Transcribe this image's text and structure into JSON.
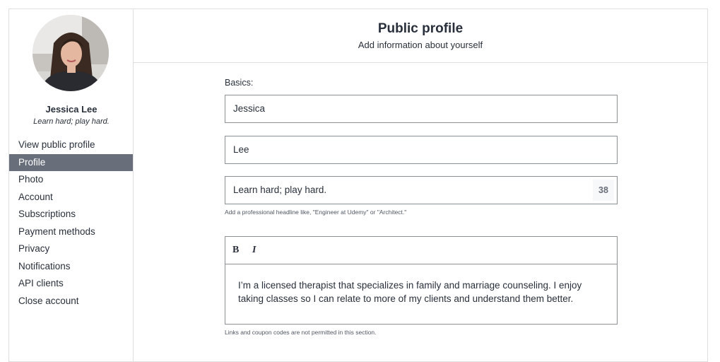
{
  "profile": {
    "name": "Jessica Lee",
    "headline": "Learn hard; play hard.",
    "avatar_icon": "user-photo-icon"
  },
  "nav": {
    "items": [
      {
        "label": "View public profile"
      },
      {
        "label": "Profile"
      },
      {
        "label": "Photo"
      },
      {
        "label": "Account"
      },
      {
        "label": "Subscriptions"
      },
      {
        "label": "Payment methods"
      },
      {
        "label": "Privacy"
      },
      {
        "label": "Notifications"
      },
      {
        "label": "API clients"
      },
      {
        "label": "Close account"
      }
    ],
    "active_index": 1
  },
  "header": {
    "title": "Public profile",
    "subtitle": "Add information about yourself"
  },
  "form": {
    "basics_label": "Basics:",
    "first_name": "Jessica",
    "last_name": "Lee",
    "headline_value": "Learn hard; play hard.",
    "headline_counter": "38",
    "headline_help": "Add a professional headline like, \"Engineer at Udemy\" or \"Architect.\"",
    "bio_toolbar": {
      "bold": "B",
      "italic": "I"
    },
    "bio_text": "I’m a licensed therapist that specializes in family and marriage counseling. I enjoy taking classes so I can relate to more of my clients and understand them better.",
    "bio_help": "Links and coupon codes are not permitted in this section."
  },
  "colors": {
    "active_nav_bg": "#686f7a",
    "text": "#29303b",
    "border": "#dedfe0"
  }
}
